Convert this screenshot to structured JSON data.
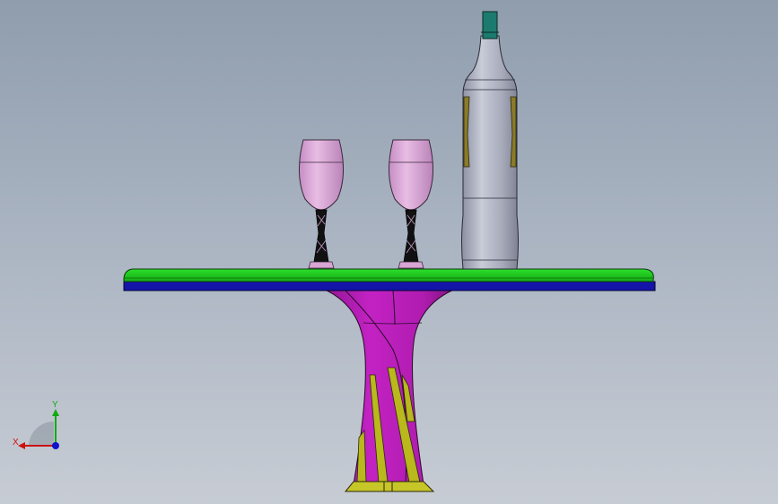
{
  "app": {
    "view": "cad-3d-viewport"
  },
  "triad": {
    "x_label": "X",
    "y_label": "Y",
    "colors": {
      "x": "#cc1111",
      "y": "#11aa11",
      "z": "#1111cc"
    }
  },
  "model": {
    "parts": [
      "table-top",
      "table-pedestal",
      "wine-glass",
      "wine-glass",
      "wine-bottle"
    ],
    "colors": {
      "table_top_face": "#19c619",
      "table_top_edge": "#1a1aa6",
      "pedestal": "#b31bb3",
      "pedestal_inlay": "#b3b31a",
      "glass_bowl": "#d9a5d4",
      "bottle_body": "#a9adbc",
      "bottle_cap": "#1c7a6e",
      "bottle_label": "#8a7a2a"
    }
  }
}
